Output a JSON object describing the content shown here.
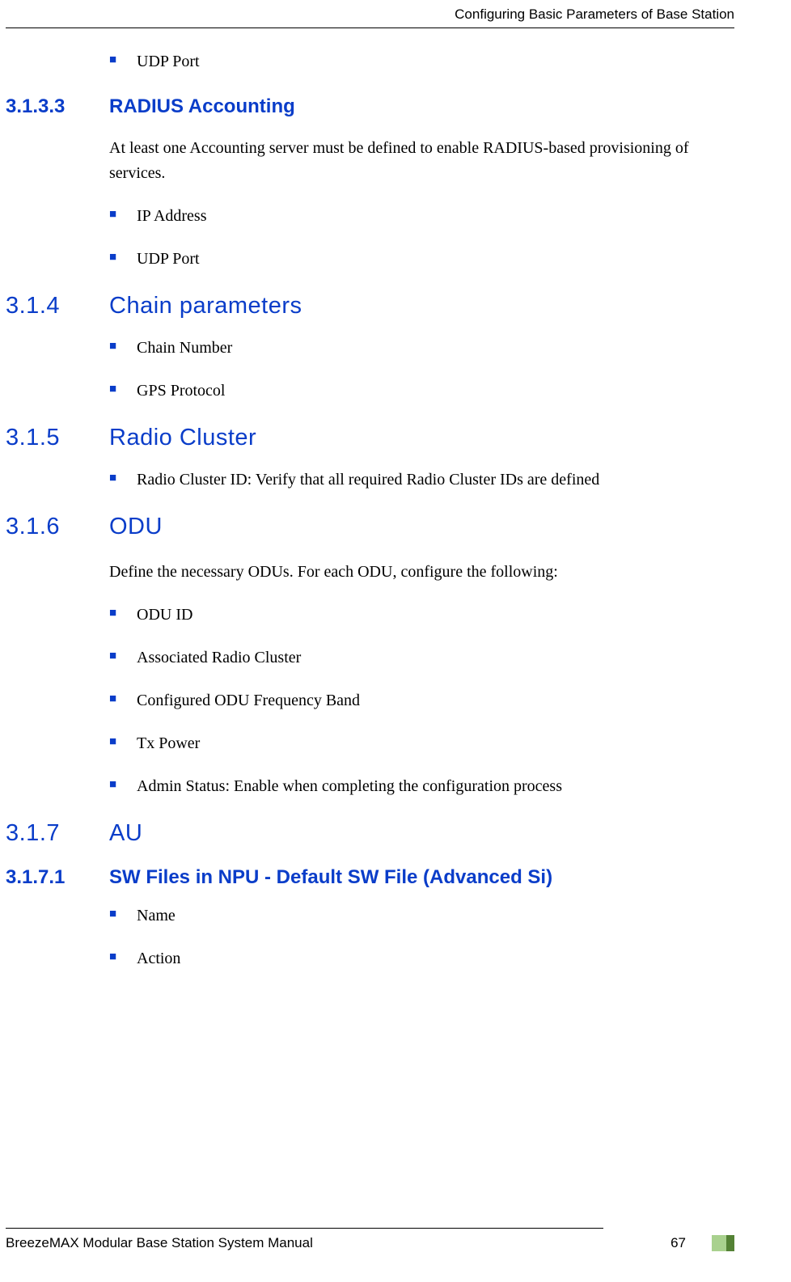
{
  "header": {
    "title": "Configuring Basic Parameters of Base Station"
  },
  "topBullets": [
    "UDP Port"
  ],
  "sec3133": {
    "num": "3.1.3.3",
    "title": "RADIUS Accounting",
    "body": "At least one Accounting server must be defined to enable RADIUS-based provisioning of services.",
    "bullets": [
      "IP Address",
      "UDP Port"
    ]
  },
  "sec314": {
    "num": "3.1.4",
    "title": "Chain parameters",
    "bullets": [
      "Chain Number",
      "GPS Protocol"
    ]
  },
  "sec315": {
    "num": "3.1.5",
    "title": "Radio Cluster",
    "bullets": [
      "Radio Cluster ID: Verify that all required Radio Cluster IDs are defined"
    ]
  },
  "sec316": {
    "num": "3.1.6",
    "title": "ODU",
    "body": "Define the necessary ODUs. For each ODU, configure the following:",
    "bullets": [
      "ODU ID",
      "Associated Radio Cluster",
      "Configured ODU Frequency Band",
      "Tx Power",
      "Admin Status: Enable when completing the configuration process"
    ]
  },
  "sec317": {
    "num": "3.1.7",
    "title": "AU"
  },
  "sec3171": {
    "num": "3.1.7.1",
    "title": "SW Files in NPU - Default SW File (Advanced Si)",
    "bullets": [
      "Name",
      "Action"
    ]
  },
  "footer": {
    "title": "BreezeMAX Modular Base Station System Manual",
    "page": "67"
  }
}
